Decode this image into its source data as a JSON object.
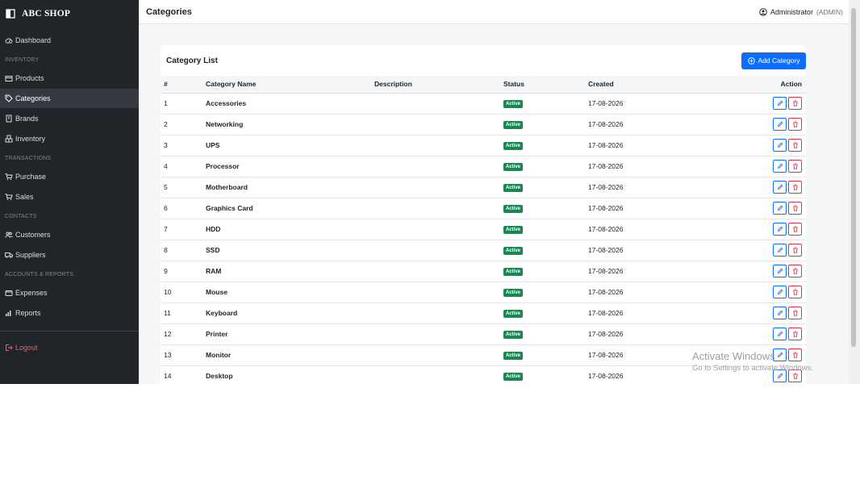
{
  "brand": {
    "name": "ABC SHOP"
  },
  "sidebar": {
    "dashboard": "Dashboard",
    "inventory_section": "INVENTORY",
    "products": "Products",
    "categories": "Categories",
    "brands": "Brands",
    "inventory": "Inventory",
    "transactions_section": "TRANSACTIONS",
    "purchase": "Purchase",
    "sales": "Sales",
    "contacts_section": "CONTACTS",
    "customers": "Customers",
    "suppliers": "Suppliers",
    "accounts_section": "ACCOUNTS & REPORTS",
    "expenses": "Expenses",
    "reports": "Reports",
    "logout": "Logout"
  },
  "header": {
    "title": "Categories",
    "user_name": "Administrator",
    "user_role": "(ADMIN)"
  },
  "card": {
    "title": "Category List",
    "add_label": "Add Category"
  },
  "table": {
    "columns": [
      "#",
      "Category Name",
      "Description",
      "Status",
      "Created",
      "Action"
    ],
    "rows": [
      {
        "num": "1",
        "name": "Accessories",
        "description": "",
        "status": "Active",
        "created": "17-08-2026"
      },
      {
        "num": "2",
        "name": "Networking",
        "description": "",
        "status": "Active",
        "created": "17-08-2026"
      },
      {
        "num": "3",
        "name": "UPS",
        "description": "",
        "status": "Active",
        "created": "17-08-2026"
      },
      {
        "num": "4",
        "name": "Processor",
        "description": "",
        "status": "Active",
        "created": "17-08-2026"
      },
      {
        "num": "5",
        "name": "Motherboard",
        "description": "",
        "status": "Active",
        "created": "17-08-2026"
      },
      {
        "num": "6",
        "name": "Graphics Card",
        "description": "",
        "status": "Active",
        "created": "17-08-2026"
      },
      {
        "num": "7",
        "name": "HDD",
        "description": "",
        "status": "Active",
        "created": "17-08-2026"
      },
      {
        "num": "8",
        "name": "SSD",
        "description": "",
        "status": "Active",
        "created": "17-08-2026"
      },
      {
        "num": "9",
        "name": "RAM",
        "description": "",
        "status": "Active",
        "created": "17-08-2026"
      },
      {
        "num": "10",
        "name": "Mouse",
        "description": "",
        "status": "Active",
        "created": "17-08-2026"
      },
      {
        "num": "11",
        "name": "Keyboard",
        "description": "",
        "status": "Active",
        "created": "17-08-2026"
      },
      {
        "num": "12",
        "name": "Printer",
        "description": "",
        "status": "Active",
        "created": "17-08-2026"
      },
      {
        "num": "13",
        "name": "Monitor",
        "description": "",
        "status": "Active",
        "created": "17-08-2026"
      },
      {
        "num": "14",
        "name": "Desktop",
        "description": "",
        "status": "Active",
        "created": "17-08-2026"
      }
    ]
  },
  "watermark": {
    "line1": "Activate Windows",
    "line2": "Go to Settings to activate Windows."
  },
  "colors": {
    "sidebar_bg": "#212529",
    "primary": "#0d6efd",
    "success": "#198754",
    "danger": "#dc3545",
    "logout": "#e4606d"
  },
  "icons": {
    "brand": "box-icon",
    "dashboard": "speedometer-icon",
    "products": "box-icon",
    "categories": "tag-icon",
    "brands": "building-icon",
    "inventory": "boxes-icon",
    "purchase": "cart-icon",
    "sales": "cart-icon",
    "customers": "people-icon",
    "suppliers": "truck-icon",
    "expenses": "wallet-icon",
    "reports": "bar-chart-icon",
    "logout": "logout-icon",
    "user": "person-circle-icon",
    "add": "plus-circle-icon",
    "edit": "pencil-icon",
    "delete": "trash-icon"
  }
}
